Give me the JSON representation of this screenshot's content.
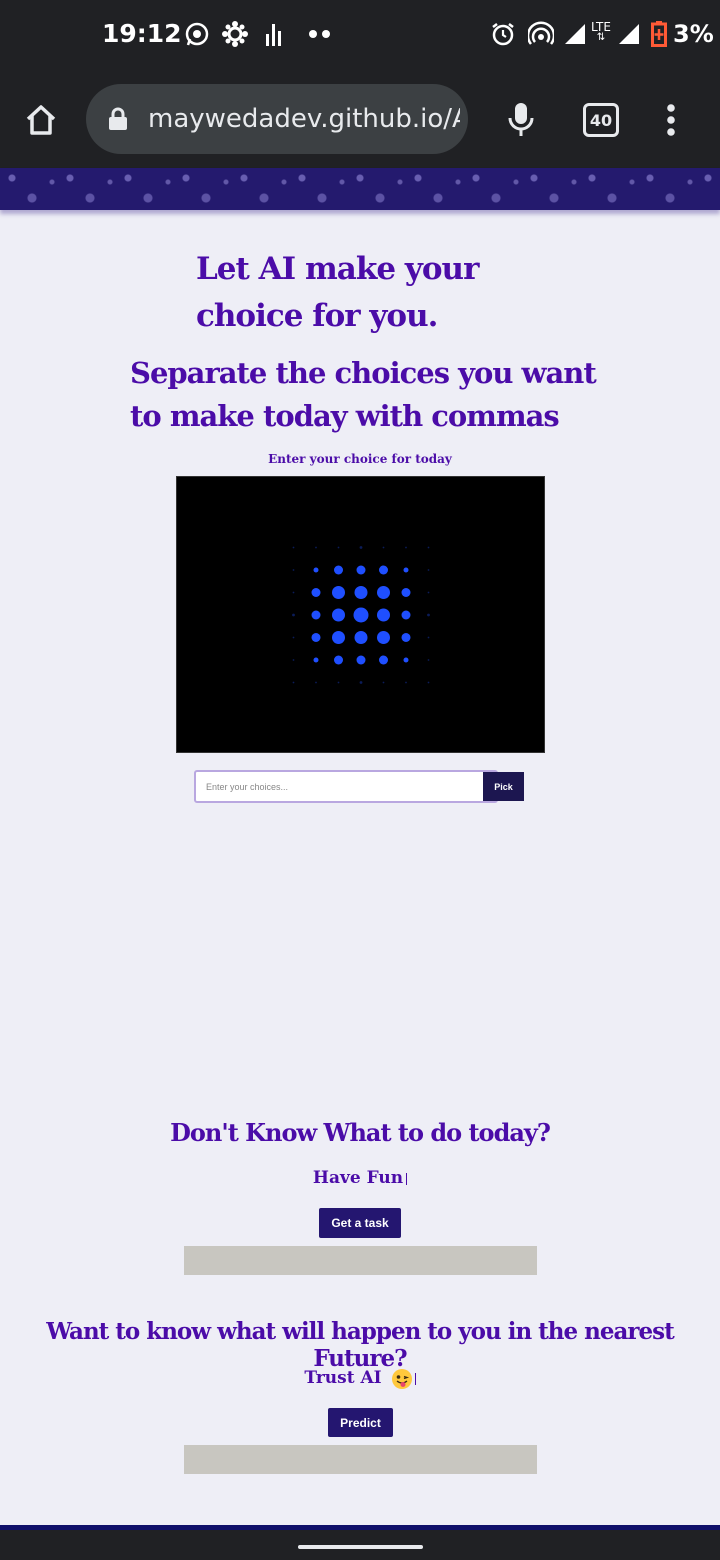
{
  "status_bar": {
    "time": "19:12",
    "network": "LTE",
    "battery": "3%",
    "icons": [
      "whatsapp-icon",
      "app-icon",
      "equalizer-icon",
      "more-dots-icon",
      "alarm-icon",
      "hotspot-icon",
      "signal-icon",
      "battery-low-icon"
    ]
  },
  "browser": {
    "url": "maywedadev.github.io/A",
    "tab_count": "40"
  },
  "page": {
    "title": "Let AI make your choice for you.",
    "subtitle": "Separate the choices you want to make today with commas",
    "input_label": "Enter your choice for today",
    "choice_placeholder": "Enter your choices...",
    "pick_label": "Pick",
    "section1": {
      "title": "Don't Know What to do today?",
      "typing_text": "Have Fun",
      "button": "Get a task"
    },
    "section2": {
      "title": "Want to know what will happen to you in the nearest Future?",
      "typing_text": "Trust AI",
      "emoji": "😜",
      "button": "Predict"
    }
  },
  "colors": {
    "accent_purple": "#4b0ca8",
    "button_navy": "#241670",
    "dot_blue": "#1f4fff",
    "page_bg": "#eeeef6"
  }
}
